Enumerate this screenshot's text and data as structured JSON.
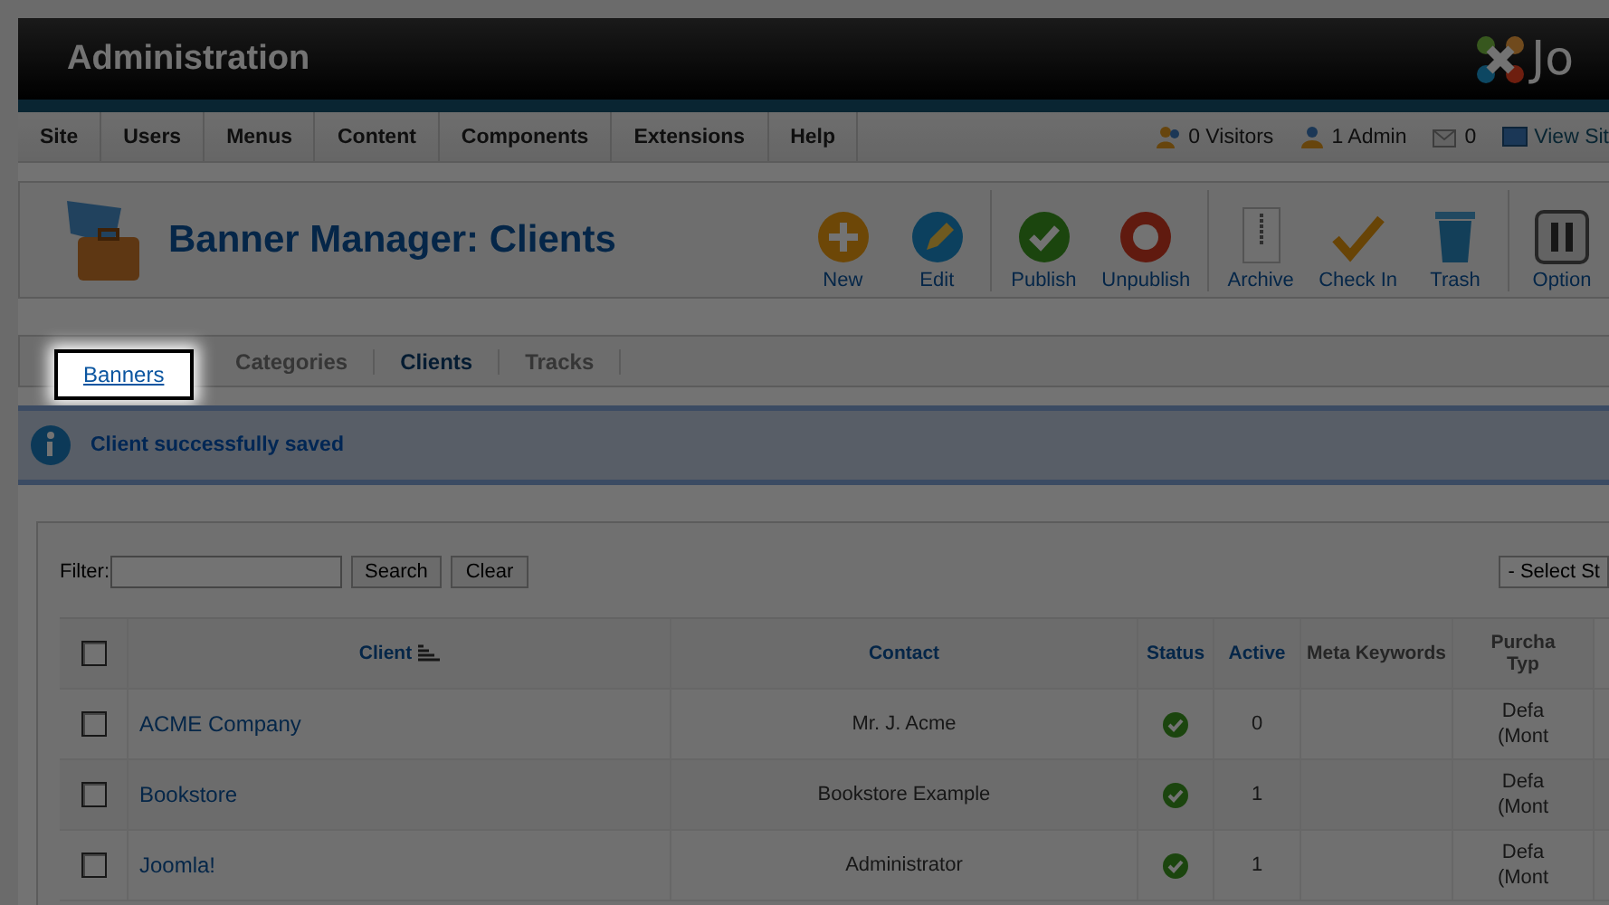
{
  "header": {
    "title": "Administration",
    "logo_text": "Jo"
  },
  "menu": {
    "items": [
      "Site",
      "Users",
      "Menus",
      "Content",
      "Components",
      "Extensions",
      "Help"
    ],
    "status": [
      {
        "kind": "visitors",
        "text": "0 Visitors"
      },
      {
        "kind": "admins",
        "text": "1 Admin"
      },
      {
        "kind": "messages",
        "text": "0"
      },
      {
        "kind": "site",
        "text": "View Sit"
      }
    ]
  },
  "toolbar": {
    "title": "Banner Manager: Clients",
    "buttons": [
      {
        "kind": "new",
        "label": "New"
      },
      {
        "kind": "edit",
        "label": "Edit"
      },
      {
        "kind": "publish",
        "label": "Publish"
      },
      {
        "kind": "unpublish",
        "label": "Unpublish"
      },
      {
        "kind": "archive",
        "label": "Archive"
      },
      {
        "kind": "checkin",
        "label": "Check In"
      },
      {
        "kind": "trash",
        "label": "Trash"
      },
      {
        "kind": "options",
        "label": "Option"
      }
    ]
  },
  "tabs": [
    {
      "label": "Banners",
      "selected": false,
      "highlighted": true
    },
    {
      "label": "Categories",
      "selected": false,
      "highlighted": false
    },
    {
      "label": "Clients",
      "selected": true,
      "highlighted": false
    },
    {
      "label": "Tracks",
      "selected": false,
      "highlighted": false
    }
  ],
  "message": {
    "text": "Client successfully saved"
  },
  "filter": {
    "label": "Filter:",
    "search_button": "Search",
    "clear_button": "Clear",
    "state_select": "- Select St"
  },
  "table": {
    "columns": [
      {
        "label": "Client",
        "sorted": true
      },
      {
        "label": "Contact",
        "sorted": false
      },
      {
        "label": "Status",
        "sorted": false
      },
      {
        "label": "Active",
        "sorted": false
      },
      {
        "label": "Meta Keywords",
        "sorted": false
      },
      {
        "label": "Purcha Typ",
        "sorted": false
      }
    ],
    "all_checked": false,
    "rows": [
      {
        "checked": false,
        "client": "ACME Company",
        "contact": "Mr. J. Acme",
        "published": true,
        "active": "0",
        "purchase_type": "Defa (Mont"
      },
      {
        "checked": false,
        "client": "Bookstore",
        "contact": "Bookstore Example",
        "published": true,
        "active": "1",
        "purchase_type": "Defa (Mont"
      },
      {
        "checked": false,
        "client": "Joomla!",
        "contact": "Administrator",
        "published": true,
        "active": "1",
        "purchase_type": "Defa (Mont"
      }
    ]
  }
}
